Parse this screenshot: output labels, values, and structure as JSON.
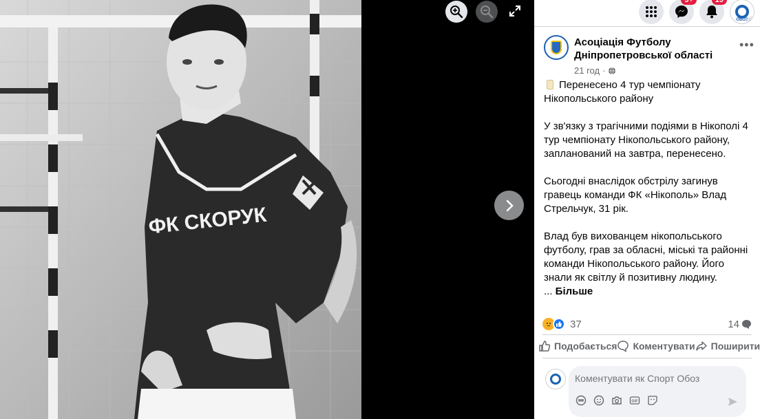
{
  "viewer": {
    "zoom_in_icon": "zoom-in-icon",
    "zoom_out_icon": "zoom-out-icon",
    "expand_icon": "expand-icon",
    "next_icon": "chevron-right-icon",
    "photo_shirt_text": "ФК СКОРУК"
  },
  "topbar": {
    "messenger_badge": "9+",
    "notifications_badge": "19",
    "avatar_small_text": "ОБОЗ"
  },
  "post": {
    "page_name": "Асоціація Футболу Дніпропетровської області",
    "time": "21 год",
    "paragraphs": [
      "Перенесено 4 тур чемпіонату Нікопольського району",
      "У зв'язку з трагічними подіями в Нікополі 4 тур чемпіонату Нікопольського району, запланований на завтра, перенесено.",
      "Сьогодні внаслідок обстрілу загинув гравець команди ФК «Нікополь» Влад Стрельчук, 31 рік.",
      "Влад був вихованцем нікопольського футболу, грав за обласні, міські та районні команди Нікопольського району. Його знали як світлу й позитивну людину."
    ],
    "more_prefix": "... ",
    "more_label": "Більше",
    "reaction_count": "37",
    "comment_count": "14"
  },
  "actions": {
    "like": "Подобається",
    "comment": "Коментувати",
    "share": "Поширити"
  },
  "comment": {
    "placeholder": "Коментувати як Спорт Обоз"
  },
  "colors": {
    "accent": "#1877f2",
    "badge": "#e41e3f",
    "panel_bg": "#ffffff",
    "viewer_bg": "#000000"
  }
}
